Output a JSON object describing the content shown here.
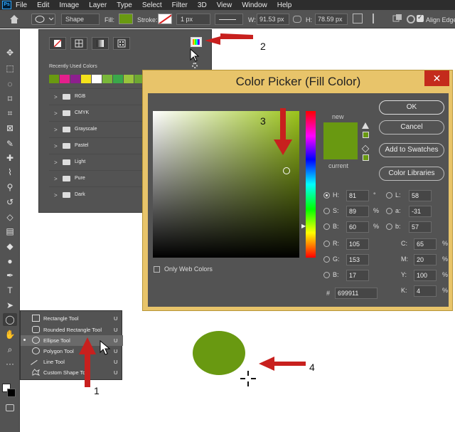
{
  "menubar": {
    "logo": "Ps",
    "items": [
      "File",
      "Edit",
      "Image",
      "Layer",
      "Type",
      "Select",
      "Filter",
      "3D",
      "View",
      "Window",
      "Help"
    ]
  },
  "options_bar": {
    "mode": "Shape",
    "fill_label": "Fill:",
    "fill_color": "#699911",
    "stroke_label": "Stroke:",
    "stroke_width": "1 px",
    "w_label": "W:",
    "w_value": "91.53 px",
    "h_label": "H:",
    "h_value": "78.59 px",
    "align_edges_label": "Align Edges"
  },
  "toolbar": {
    "icons": [
      "move-icon",
      "marquee-icon",
      "lasso-icon",
      "quick-select-icon",
      "crop-icon",
      "frame-icon",
      "eyedropper-icon",
      "healing-icon",
      "brush-icon",
      "stamp-icon",
      "history-brush-icon",
      "eraser-icon",
      "gradient-icon",
      "blur-icon",
      "dodge-icon",
      "pen-icon",
      "type-icon",
      "path-select-icon",
      "ellipse-icon",
      "hand-icon",
      "zoom-icon",
      "more-icon"
    ]
  },
  "swatch_panel": {
    "recent_label": "Recently Used Colors",
    "recent_colors": [
      "#699911",
      "#e41f8c",
      "#8d1f8e",
      "#f4e21b",
      "#ffffff",
      "#79b83a",
      "#3aa84a",
      "#9ac43c",
      "#6da832",
      "#4c9a2a",
      "#86b93a",
      "#aacc55"
    ],
    "folders": [
      "RGB",
      "CMYK",
      "Grayscale",
      "Pastel",
      "Light",
      "Pure",
      "Dark"
    ]
  },
  "color_picker": {
    "title": "Color Picker (Fill Color)",
    "close": "✕",
    "new_label": "new",
    "current_label": "current",
    "new_color": "#699911",
    "current_color": "#699911",
    "buttons": [
      "OK",
      "Cancel",
      "Add to Swatches",
      "Color Libraries"
    ],
    "web_only_label": "Only Web Colors",
    "hsb": [
      {
        "label": "H:",
        "value": "81",
        "unit": "°"
      },
      {
        "label": "S:",
        "value": "89",
        "unit": "%"
      },
      {
        "label": "B:",
        "value": "60",
        "unit": "%"
      }
    ],
    "rgb": [
      {
        "label": "R:",
        "value": "105"
      },
      {
        "label": "G:",
        "value": "153"
      },
      {
        "label": "B:",
        "value": "17"
      }
    ],
    "lab": [
      {
        "label": "L:",
        "value": "58"
      },
      {
        "label": "a:",
        "value": "-31"
      },
      {
        "label": "b:",
        "value": "57"
      }
    ],
    "cmyk": [
      {
        "label": "C:",
        "value": "65",
        "unit": "%"
      },
      {
        "label": "M:",
        "value": "20",
        "unit": "%"
      },
      {
        "label": "Y:",
        "value": "100",
        "unit": "%"
      },
      {
        "label": "K:",
        "value": "4",
        "unit": "%"
      }
    ],
    "hex_label": "#",
    "hex_value": "699911"
  },
  "shape_flyout": {
    "items": [
      {
        "label": "Rectangle Tool",
        "key": "U"
      },
      {
        "label": "Rounded Rectangle Tool",
        "key": "U"
      },
      {
        "label": "Ellipse Tool",
        "key": "U"
      },
      {
        "label": "Polygon Tool",
        "key": "U"
      },
      {
        "label": "Line Tool",
        "key": "U"
      },
      {
        "label": "Custom Shape Tool",
        "key": "U"
      }
    ]
  },
  "annotations": [
    "1",
    "2",
    "3",
    "4"
  ],
  "arrow_color": "#c8201e"
}
